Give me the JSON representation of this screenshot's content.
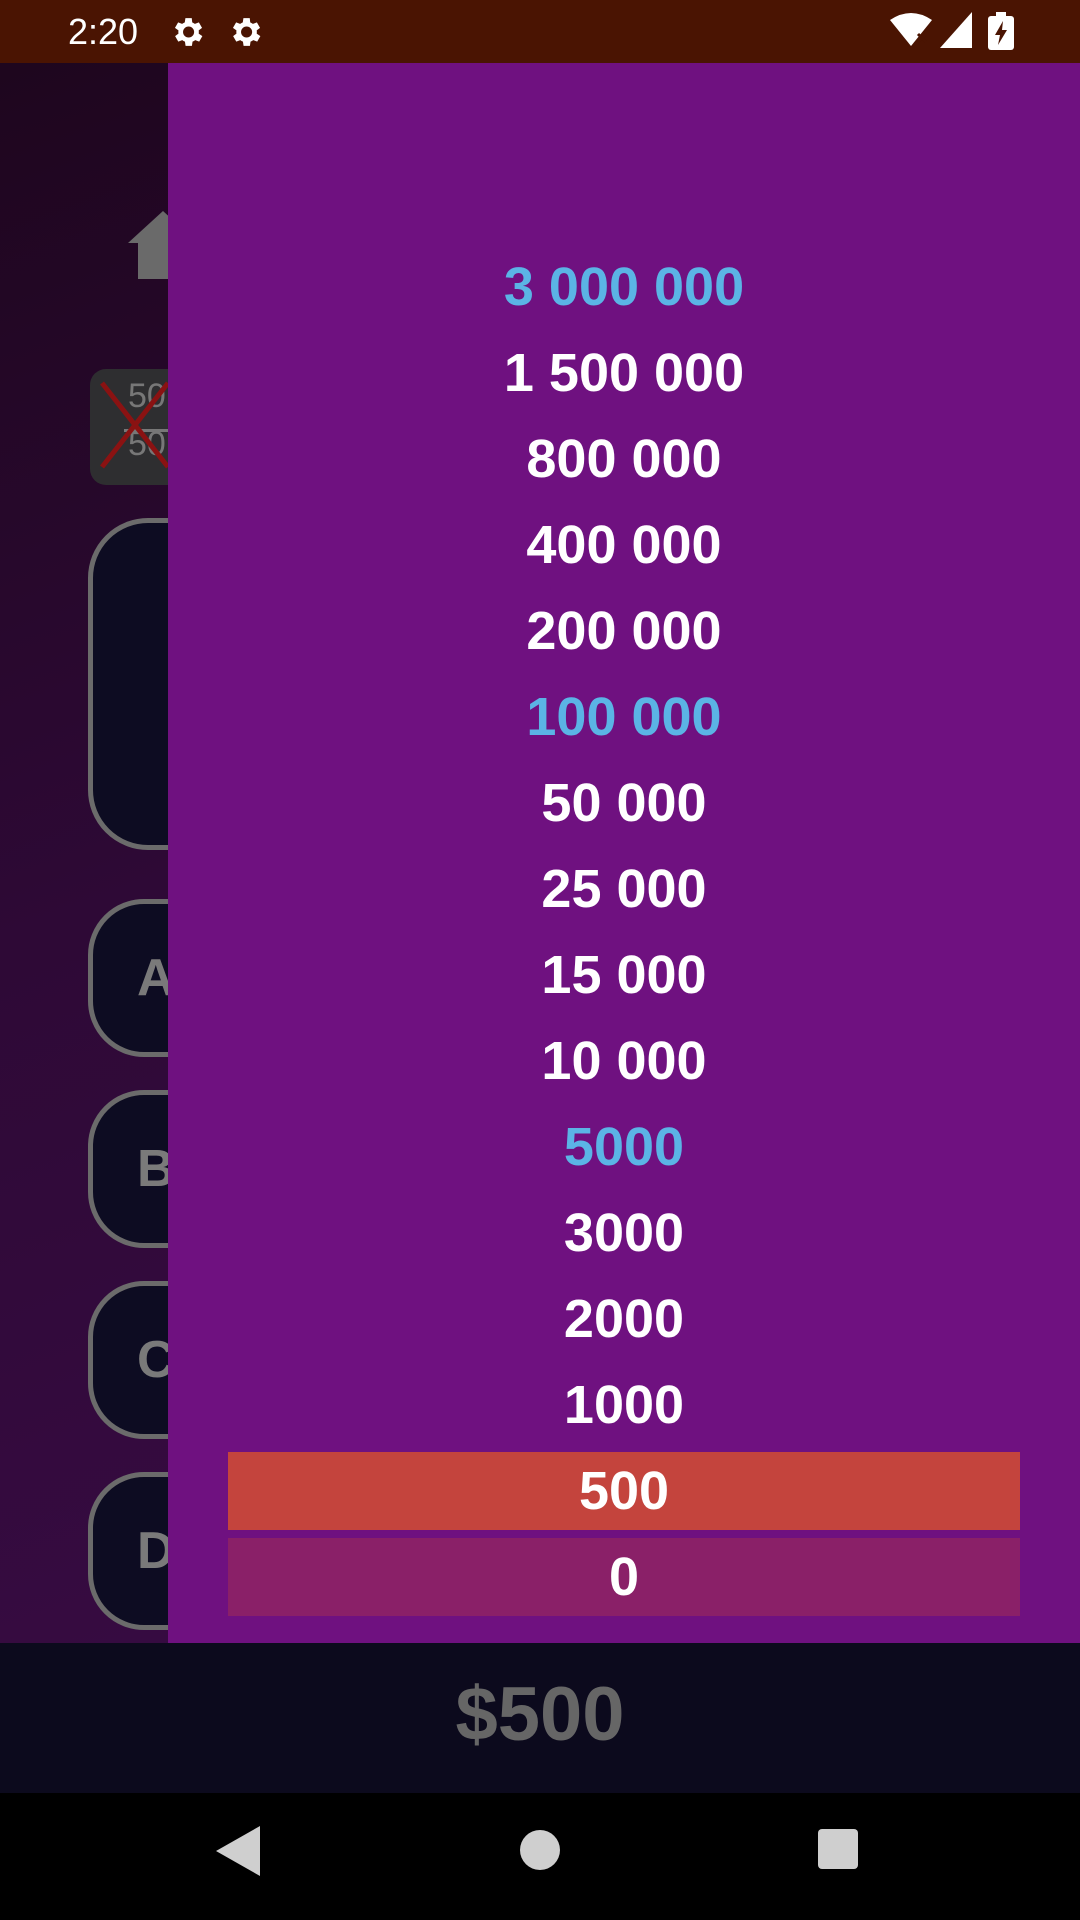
{
  "status_bar": {
    "time": "2:20",
    "icons": [
      "gear-icon",
      "gear-icon",
      "wifi-icon",
      "signal-icon",
      "battery-icon"
    ]
  },
  "game": {
    "home_icon": "home-icon",
    "lifeline": {
      "top": "50",
      "bottom": "50",
      "used": true
    },
    "answers": [
      "A",
      "B",
      "C",
      "D"
    ],
    "current_winnings": "$500"
  },
  "prize_ladder": [
    {
      "amount": "3 000 000",
      "state": "milestone"
    },
    {
      "amount": "1 500 000",
      "state": "normal"
    },
    {
      "amount": "800 000",
      "state": "normal"
    },
    {
      "amount": "400 000",
      "state": "normal"
    },
    {
      "amount": "200 000",
      "state": "normal"
    },
    {
      "amount": "100 000",
      "state": "milestone"
    },
    {
      "amount": "50 000",
      "state": "normal"
    },
    {
      "amount": "25 000",
      "state": "normal"
    },
    {
      "amount": "15 000",
      "state": "normal"
    },
    {
      "amount": "10 000",
      "state": "normal"
    },
    {
      "amount": "5000",
      "state": "milestone"
    },
    {
      "amount": "3000",
      "state": "normal"
    },
    {
      "amount": "2000",
      "state": "normal"
    },
    {
      "amount": "1000",
      "state": "normal"
    },
    {
      "amount": "500",
      "state": "current"
    },
    {
      "amount": "0",
      "state": "zero"
    }
  ],
  "colors": {
    "status_bar": "#4a1402",
    "drawer": "#6f1180",
    "milestone": "#5bb4e5",
    "current_row": "#c4443d",
    "zero_row": "#8a2068"
  },
  "nav": [
    "back-icon",
    "home-circle-icon",
    "recents-icon"
  ]
}
